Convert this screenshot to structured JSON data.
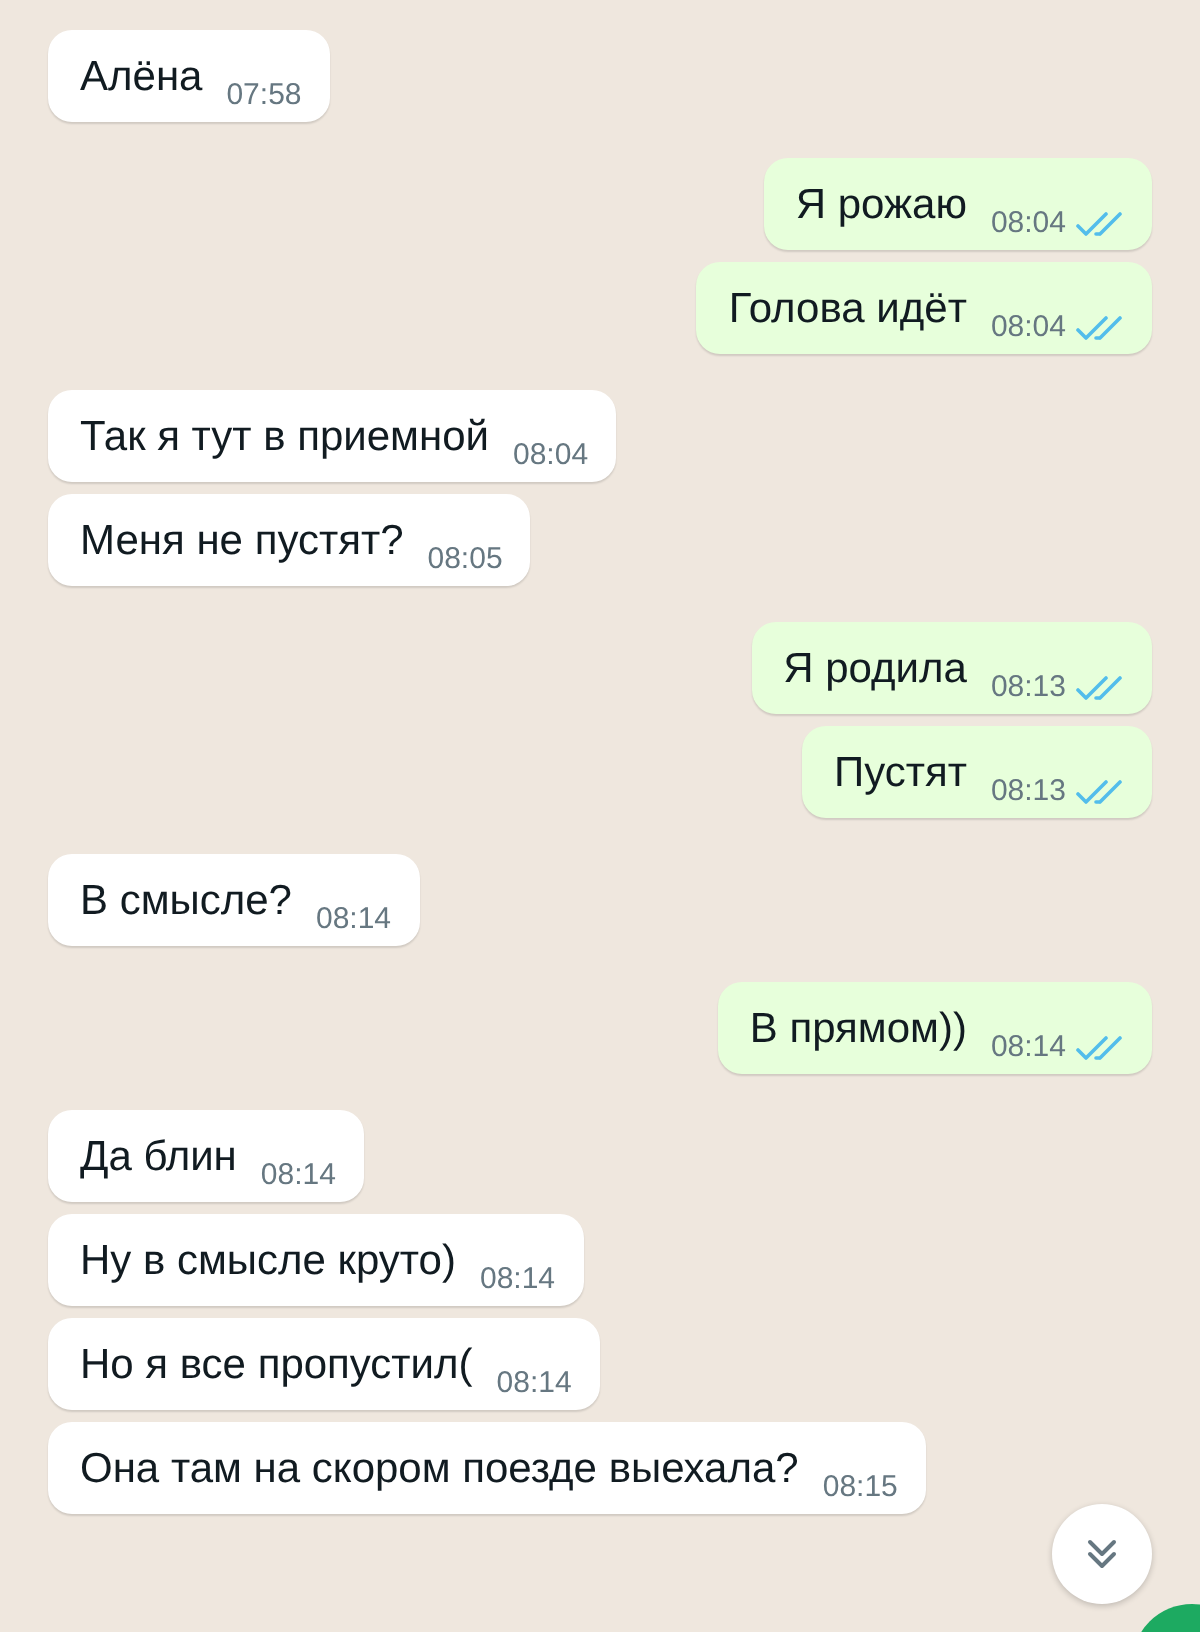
{
  "messages": [
    {
      "kind": "in",
      "text": "Алёна",
      "time": "07:58"
    },
    {
      "kind": "out",
      "text": "Я рожаю",
      "time": "08:04",
      "read": true
    },
    {
      "kind": "out",
      "text": "Голова идёт",
      "time": "08:04",
      "read": true
    },
    {
      "kind": "in",
      "text": "Так я тут в приемной",
      "time": "08:04"
    },
    {
      "kind": "in",
      "text": "Меня не пустят?",
      "time": "08:05"
    },
    {
      "kind": "out",
      "text": "Я родила",
      "time": "08:13",
      "read": true
    },
    {
      "kind": "out",
      "text": "Пустят",
      "time": "08:13",
      "read": true
    },
    {
      "kind": "in",
      "text": "В смысле?",
      "time": "08:14"
    },
    {
      "kind": "out",
      "text": "В прямом))",
      "time": "08:14",
      "read": true
    },
    {
      "kind": "in",
      "text": "Да блин",
      "time": "08:14"
    },
    {
      "kind": "in",
      "text": "Ну в смысле круто)",
      "time": "08:14"
    },
    {
      "kind": "in",
      "text": "Но я все пропустил(",
      "time": "08:14"
    },
    {
      "kind": "in",
      "text": "Она там на скором поезде выехала?",
      "time": "08:15"
    }
  ]
}
